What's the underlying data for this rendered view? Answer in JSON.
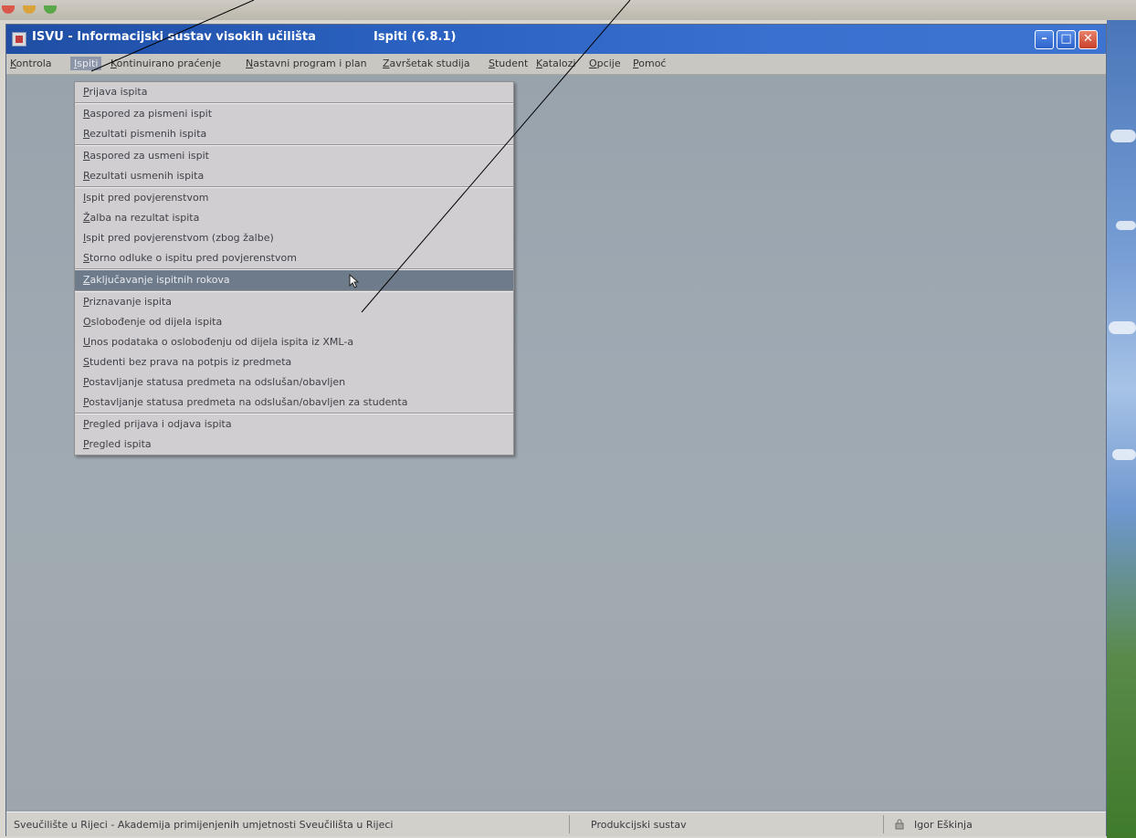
{
  "window": {
    "title": "ISVU - Informacijski sustav visokih učilišta",
    "version": "Ispiti (6.8.1)",
    "controls": [
      "minimize",
      "maximize",
      "close"
    ]
  },
  "menubar": {
    "items": [
      {
        "label": "Kontrola"
      },
      {
        "label": "Ispiti",
        "active": true
      },
      {
        "label": "Kontinuirano praćenje"
      },
      {
        "label": "Nastavni program i plan"
      },
      {
        "label": "Završetak studija"
      },
      {
        "label": "Student"
      },
      {
        "label": "Katalozi"
      },
      {
        "label": "Opcije"
      },
      {
        "label": "Pomoć"
      }
    ]
  },
  "dropdown": {
    "groups": [
      [
        "Prijava ispita"
      ],
      [
        "Raspored za pismeni ispit",
        "Rezultati pismenih ispita"
      ],
      [
        "Raspored za usmeni ispit",
        "Rezultati usmenih ispita"
      ],
      [
        "Ispit pred povjerenstvom",
        "Žalba na rezultat ispita",
        "Ispit pred povjerenstvom (zbog žalbe)",
        "Storno odluke o ispitu pred povjerenstvom"
      ],
      [
        "Zaključavanje ispitnih rokova"
      ],
      [
        "Priznavanje ispita",
        "Oslobođenje od dijela ispita",
        "Unos podataka o oslobođenju od dijela ispita iz XML-a",
        "Studenti bez prava na potpis iz predmeta",
        "Postavljanje statusa predmeta na odslušan/obavljen",
        "Postavljanje statusa predmeta na odslušan/obavljen za studenta"
      ],
      [
        "Pregled prijava i odjava ispita",
        "Pregled ispita"
      ]
    ],
    "highlighted": "Zaključavanje ispitnih rokova"
  },
  "statusbar": {
    "institution": "Sveučilište u Rijeci - Akademija primijenjenih umjetnosti Sveučilišta u Rijeci",
    "environment": "Produkcijski sustav",
    "user": "Igor Eškinja"
  },
  "colors": {
    "titlebar": "#2c63c3",
    "menubar": "#c9c7c1",
    "highlight": "#6e7b8a",
    "content": "#9fa9b2",
    "annotation_line": "#000000"
  }
}
